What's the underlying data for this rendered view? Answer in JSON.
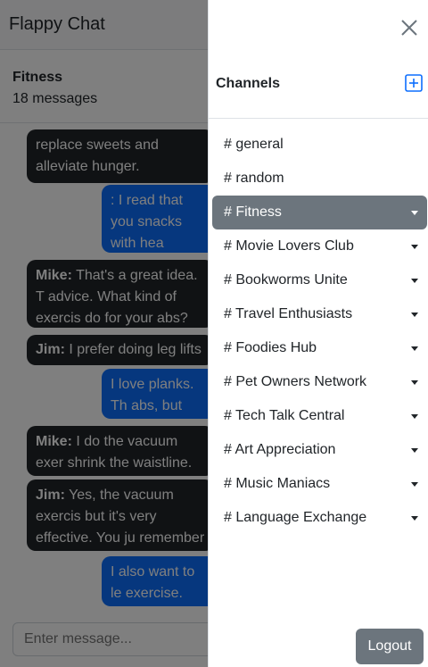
{
  "app": {
    "title": "Flappy Chat"
  },
  "channel_header": {
    "name": "Fitness",
    "count": "18 messages"
  },
  "messages": [
    {
      "author": "",
      "text": "replace sweets and alleviate hunger.",
      "side": "other"
    },
    {
      "author": "",
      "text": ": I read that you snacks with hea cookies instead",
      "side": "mine"
    },
    {
      "author": "Mike:",
      "text": " That's a great idea. T advice. What kind of exercis do for your abs?",
      "side": "other"
    },
    {
      "author": "Jim:",
      "text": " I prefer doing leg lifts a",
      "side": "other"
    },
    {
      "author": "",
      "text": "I love planks. Th abs, but also he",
      "side": "mine"
    },
    {
      "author": "Mike:",
      "text": " I do the vacuum exer shrink the waistline. But it's",
      "side": "other"
    },
    {
      "author": "Jim:",
      "text": " Yes, the vacuum exercis but it's very effective. You ju remember to do it regularly",
      "side": "other"
    },
    {
      "author": "",
      "text": "I also want to le exercise. Can yo",
      "side": "mine"
    }
  ],
  "composer": {
    "placeholder": "Enter message..."
  },
  "drawer": {
    "title": "Channels",
    "channels": [
      {
        "label": "# general",
        "dropdown": false,
        "active": false
      },
      {
        "label": "# random",
        "dropdown": false,
        "active": false
      },
      {
        "label": "# Fitness",
        "dropdown": true,
        "active": true
      },
      {
        "label": "# Movie Lovers Club",
        "dropdown": true,
        "active": false
      },
      {
        "label": "# Bookworms Unite",
        "dropdown": true,
        "active": false
      },
      {
        "label": "# Travel Enthusiasts",
        "dropdown": true,
        "active": false
      },
      {
        "label": "# Foodies Hub",
        "dropdown": true,
        "active": false
      },
      {
        "label": "# Pet Owners Network",
        "dropdown": true,
        "active": false
      },
      {
        "label": "# Tech Talk Central",
        "dropdown": true,
        "active": false
      },
      {
        "label": "# Art Appreciation",
        "dropdown": true,
        "active": false
      },
      {
        "label": "# Music Maniacs",
        "dropdown": true,
        "active": false
      },
      {
        "label": "# Language Exchange",
        "dropdown": true,
        "active": false
      }
    ],
    "logout_label": "Logout"
  },
  "colors": {
    "accent_blue": "#0d6efd",
    "dark_bubble": "#212529",
    "active_channel": "#6c757d",
    "add_icon": "#0d6efd"
  }
}
